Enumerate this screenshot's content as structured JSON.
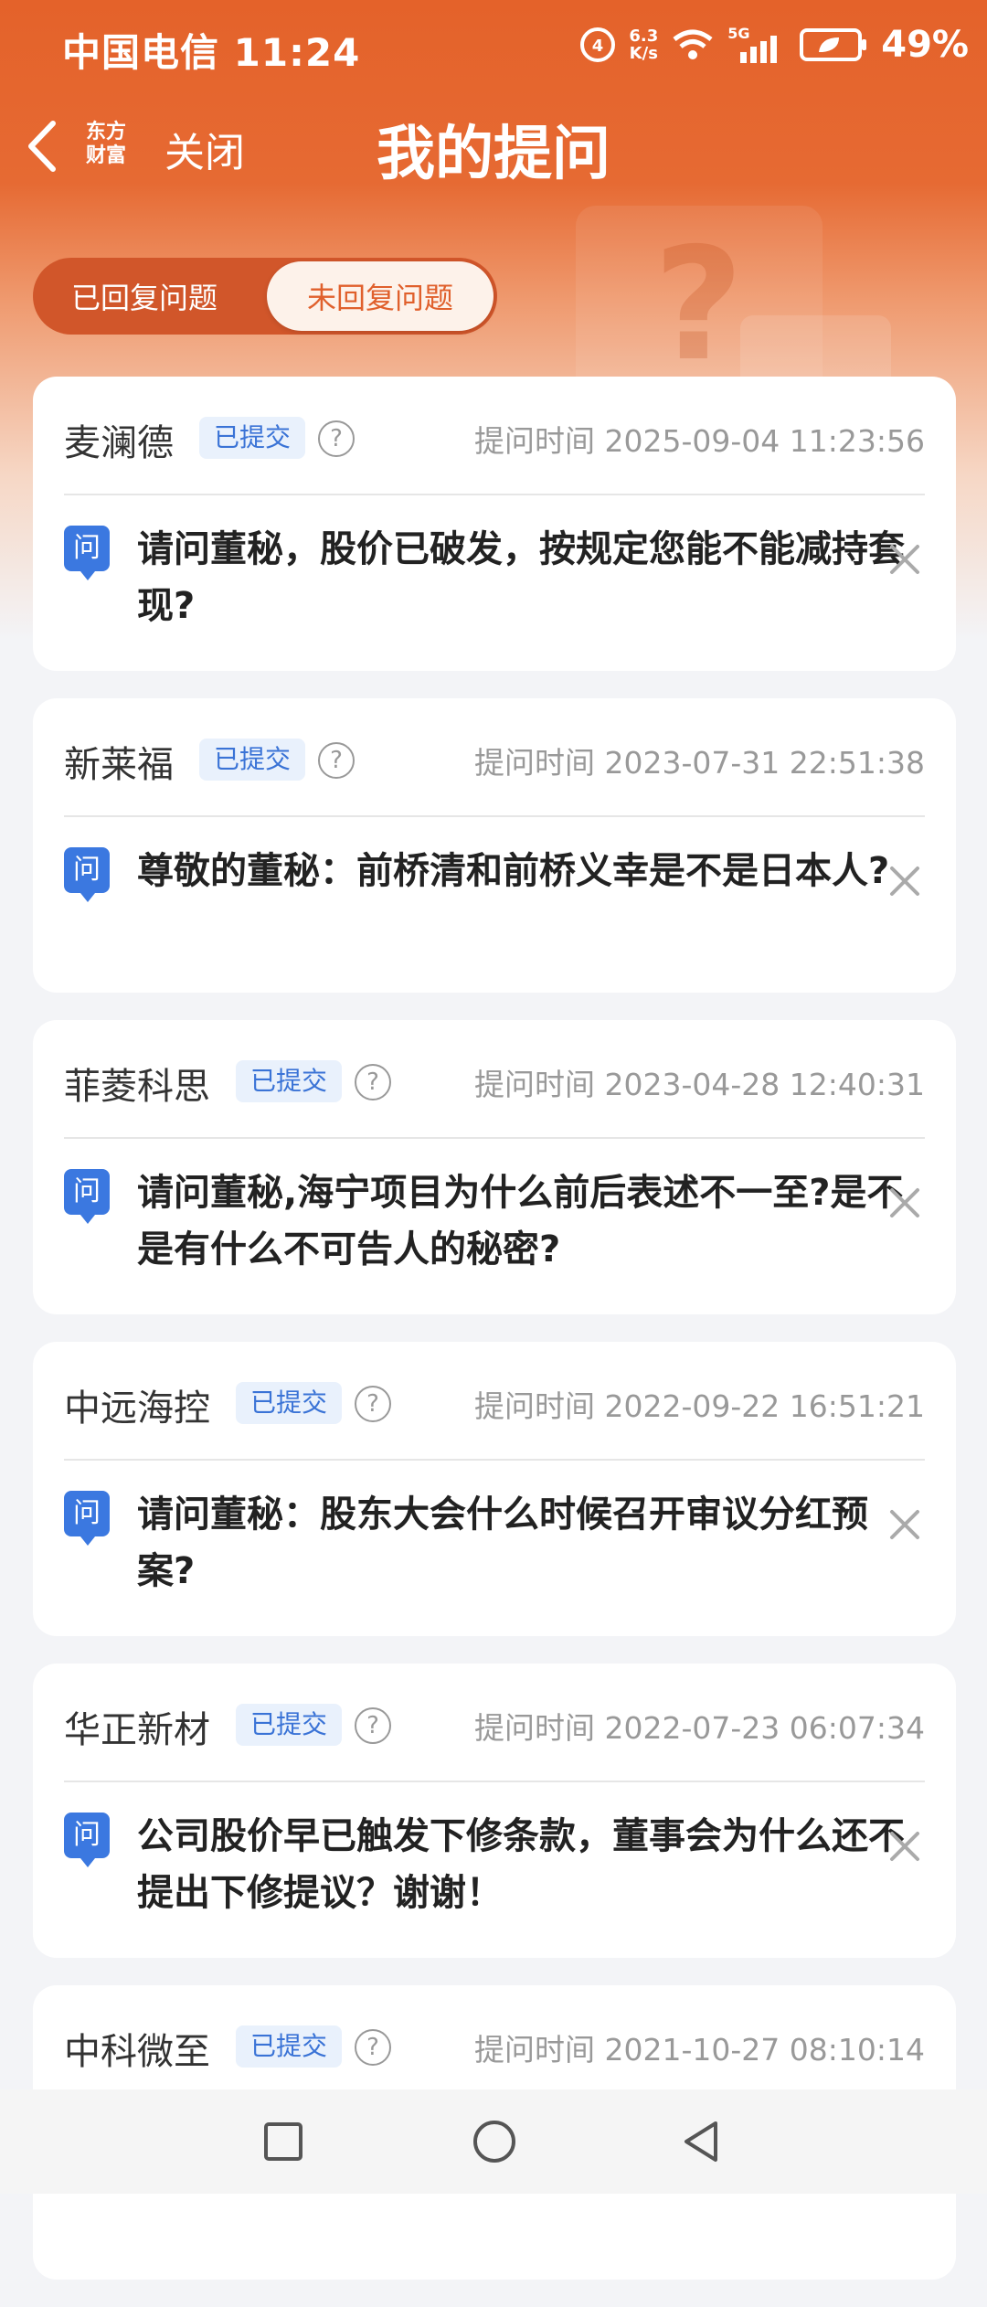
{
  "status_bar": {
    "carrier_time": "中国电信 11:24",
    "net_speed_top": "6.3",
    "net_speed_bottom": "K/s",
    "signal_label": "5G",
    "battery": "49%"
  },
  "header": {
    "logo_line1": "东方",
    "logo_line2": "财富",
    "close_label": "关闭",
    "title": "我的提问"
  },
  "tabs": {
    "answered": "已回复问题",
    "unanswered": "未回复问题"
  },
  "questions": [
    {
      "company": "麦澜德",
      "status": "已提交",
      "time": "提问时间 2025-09-04 11:23:56",
      "text": "请问董秘，股价已破发，按规定您能不能减持套现?"
    },
    {
      "company": "新莱福",
      "status": "已提交",
      "time": "提问时间 2023-07-31 22:51:38",
      "text": "尊敬的董秘：前桥清和前桥义幸是不是日本人?"
    },
    {
      "company": "菲菱科思",
      "status": "已提交",
      "time": "提问时间 2023-04-28 12:40:31",
      "text": "请问董秘,海宁项目为什么前后表述不一至?是不是有什么不可告人的秘密?"
    },
    {
      "company": "中远海控",
      "status": "已提交",
      "time": "提问时间 2022-09-22 16:51:21",
      "text": "请问董秘：股东大会什么时候召开审议分红预案?"
    },
    {
      "company": "华正新材",
      "status": "已提交",
      "time": "提问时间 2022-07-23 06:07:34",
      "text": "公司股价早已触发下修条款，董事会为什么还不提出下修提议？谢谢！"
    },
    {
      "company": "中科微至",
      "status": "已提交",
      "time": "提问时间 2021-10-27 08:10:14",
      "text": ""
    }
  ],
  "labels": {
    "question_icon": "问",
    "help_icon": "?"
  },
  "colors": {
    "brand_orange": "#e4622a",
    "badge_blue": "#3b78e0"
  }
}
